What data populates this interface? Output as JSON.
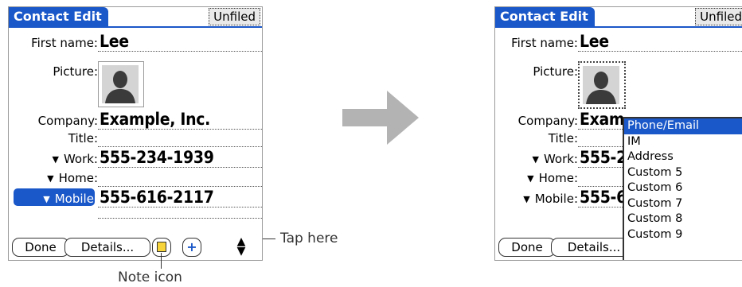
{
  "left_screen": {
    "title": "Contact Edit",
    "category": "Unfiled",
    "first_name_label": "First name:",
    "first_name_value": "Lee",
    "picture_label": "Picture:",
    "company_label": "Company:",
    "company_value": "Example, Inc.",
    "title_label": "Title:",
    "work_label": "Work:",
    "work_value": "555-234-1939",
    "home_label": "Home:",
    "mobile_label": "Mobile:",
    "mobile_value": "555-616-2117",
    "done_label": "Done",
    "details_label": "Details..."
  },
  "right_screen": {
    "title": "Contact Edit",
    "category": "Unfiled",
    "first_name_label": "First name:",
    "first_name_value": "Lee",
    "picture_label": "Picture:",
    "company_label": "Company:",
    "company_value": "Exam",
    "title_label": "Title:",
    "work_label": "Work:",
    "work_value": "555-2",
    "home_label": "Home:",
    "mobile_label": "Mobile:",
    "mobile_value": "555-6",
    "done_label": "Done",
    "details_label": "Details..."
  },
  "popup": {
    "items": [
      "Phone/Email",
      "IM",
      "Address",
      "Custom 5",
      "Custom 6",
      "Custom 7",
      "Custom 8",
      "Custom 9"
    ]
  },
  "annotations": {
    "tap_here": "Tap here",
    "note_icon": "Note icon"
  },
  "colors": {
    "accent": "#1a57c8",
    "arrow": "#b3b3b3",
    "note": "#f7d43a"
  }
}
